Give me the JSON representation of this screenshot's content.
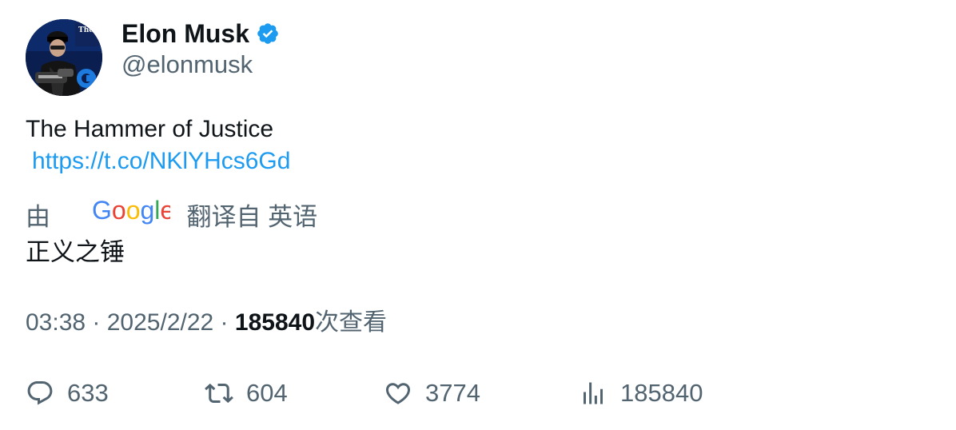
{
  "author": {
    "display_name": "Elon Musk",
    "handle": "@elonmusk",
    "verified": true,
    "avatar_label": "The Dogefa"
  },
  "tweet": {
    "text": "The Hammer of Justice",
    "link": "https://t.co/NKlYHcs6Gd"
  },
  "translation": {
    "prefix": "由",
    "provider_logo": "Google",
    "suffix": "翻译自 英语",
    "text": "正义之锤"
  },
  "meta": {
    "time": "03:38",
    "separator": " · ",
    "date": "2025/2/22",
    "views_count": "185840",
    "views_label": "次查看"
  },
  "actions": {
    "replies": "633",
    "retweets": "604",
    "likes": "3774",
    "views": "185840"
  },
  "colors": {
    "link": "#1d9bf0",
    "secondary_text": "#536471",
    "primary_text": "#0f1419",
    "verified_badge": "#1d9bf0"
  },
  "icons": {
    "reply": "reply-icon",
    "retweet": "retweet-icon",
    "like": "heart-icon",
    "views": "analytics-icon",
    "verified": "verified-badge-icon"
  }
}
